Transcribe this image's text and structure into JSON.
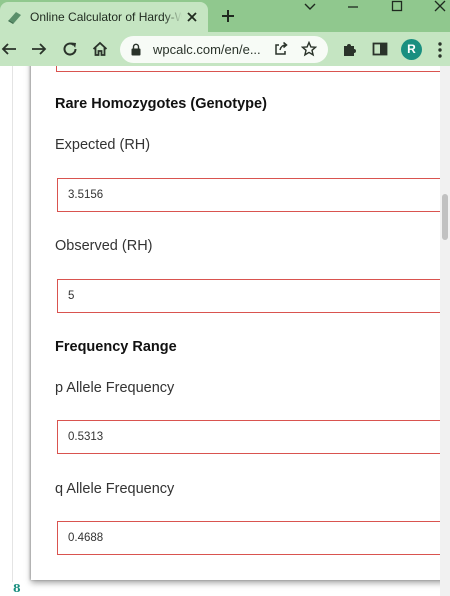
{
  "browser": {
    "tab_title": "Online Calculator of Hardy-Weinberg",
    "url": "wpcalc.com/en/e...",
    "profile_initial": "R"
  },
  "colors": {
    "frame": "#90c88e",
    "toolbar": "#c5e5c2",
    "field_border": "#d9534f",
    "avatar": "#1a8f80"
  },
  "icons": [
    "calculator-favicon-icon",
    "close-icon",
    "plus-icon",
    "chevron-down-icon",
    "minimize-icon",
    "maximize-icon",
    "close-window-icon",
    "back-arrow-icon",
    "forward-arrow-icon",
    "reload-icon",
    "home-icon",
    "lock-icon",
    "share-icon",
    "star-icon",
    "puzzle-icon",
    "side-panel-icon",
    "kebab-menu-icon"
  ],
  "form": {
    "rare_section_title": "Rare Homozygotes (Genotype)",
    "expected_rh_label": "Expected (RH)",
    "expected_rh_value": "3.5156",
    "observed_rh_label": "Observed (RH)",
    "observed_rh_value": "5",
    "frequency_section_title": "Frequency Range",
    "p_allele_label": "p Allele Frequency",
    "p_allele_value": "0.5313",
    "q_allele_label": "q Allele Frequency",
    "q_allele_value": "0.4688"
  },
  "footer": {
    "page_number": "8"
  }
}
